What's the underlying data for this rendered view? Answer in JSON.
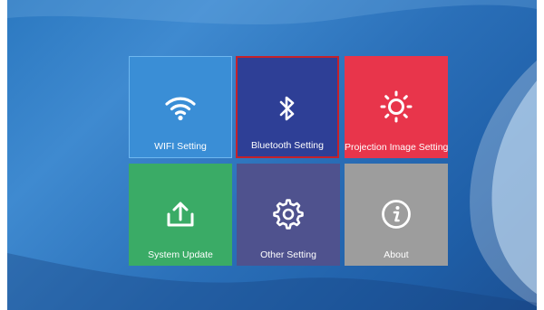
{
  "tiles": [
    {
      "id": "wifi",
      "label": "WIFI Setting",
      "icon": "wifi-icon",
      "color": "#3a8ed6",
      "selected": false
    },
    {
      "id": "bluetooth",
      "label": "Bluetooth Setting",
      "icon": "bluetooth-icon",
      "color": "#2e3f96",
      "selected": true
    },
    {
      "id": "projection",
      "label": "Projection Image Setting",
      "icon": "sun-icon",
      "color": "#e8354b",
      "selected": false
    },
    {
      "id": "system_update",
      "label": "System Update",
      "icon": "upload-icon",
      "color": "#3aab66",
      "selected": false
    },
    {
      "id": "other",
      "label": "Other Setting",
      "icon": "gear-icon",
      "color": "#4f528e",
      "selected": false
    },
    {
      "id": "about",
      "label": "About",
      "icon": "info-icon",
      "color": "#9d9d9d",
      "selected": false
    }
  ],
  "selection_color": "#c4212b"
}
